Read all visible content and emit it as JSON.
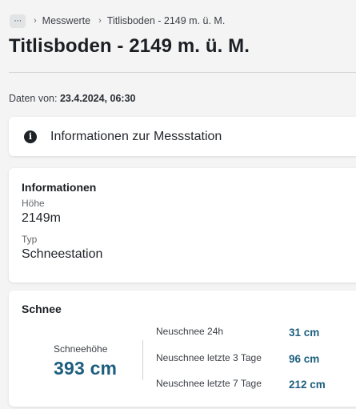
{
  "breadcrumb": {
    "more_label": "···",
    "items": [
      "Messwerte",
      "Titlisboden - 2149 m. ü. M."
    ]
  },
  "page": {
    "title": "Titlisboden - 2149 m. ü. M.",
    "date_prefix": "Daten von:",
    "date_value": "23.4.2024, 06:30"
  },
  "station_info": {
    "label": "Informationen zur Messstation",
    "icon": "info-icon"
  },
  "details": {
    "heading": "Informationen",
    "fields": [
      {
        "label": "Höhe",
        "value": "2149m"
      },
      {
        "label": "Typ",
        "value": "Schneestation"
      }
    ]
  },
  "snow": {
    "heading": "Schnee",
    "depth_label": "Schneehöhe",
    "depth_value": "393 cm",
    "new_snow": [
      {
        "label": "Neuschnee 24h",
        "value": "31 cm"
      },
      {
        "label": "Neuschnee letzte 3 Tage",
        "value": "96 cm"
      },
      {
        "label": "Neuschnee letzte 7 Tage",
        "value": "212 cm"
      }
    ]
  },
  "colors": {
    "accent": "#1d5e7e",
    "background": "#f4f4f5",
    "card": "#ffffff"
  }
}
